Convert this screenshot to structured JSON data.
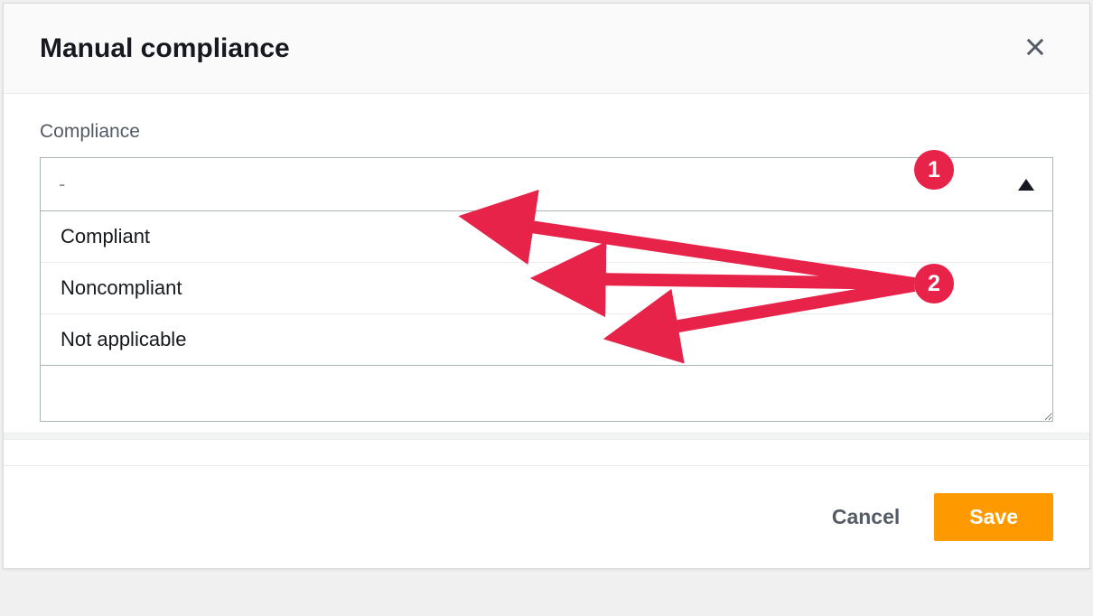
{
  "modal": {
    "title": "Manual compliance",
    "close_icon": "close"
  },
  "form": {
    "compliance_label": "Compliance",
    "select_placeholder": "-",
    "options": [
      "Compliant",
      "Noncompliant",
      "Not applicable"
    ],
    "textarea_value": ""
  },
  "footer": {
    "cancel_label": "Cancel",
    "save_label": "Save"
  },
  "annotations": {
    "badge1": "1",
    "badge2": "2",
    "color": "#e8234a"
  }
}
